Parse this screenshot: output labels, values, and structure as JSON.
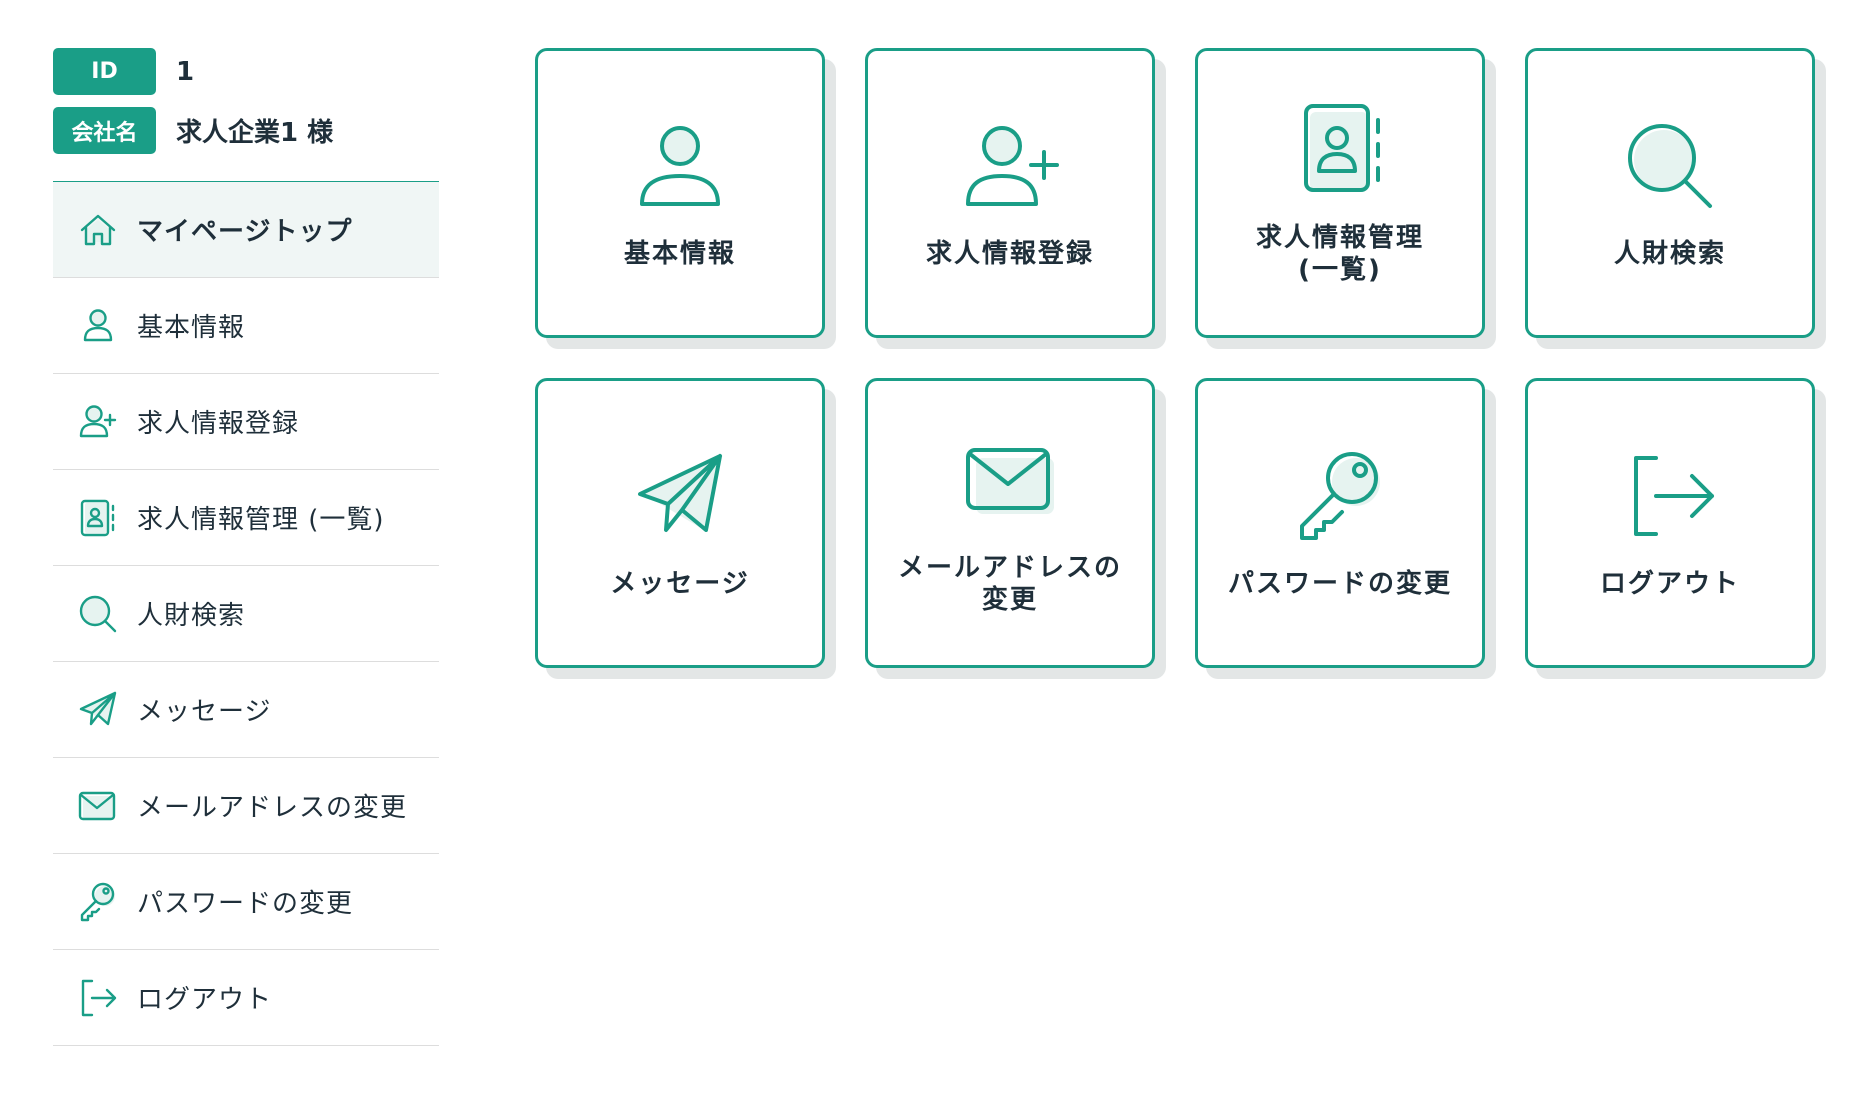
{
  "profile": {
    "id_label": "ID",
    "id_value": "1",
    "company_label": "会社名",
    "company_value": "求人企業1 様"
  },
  "sidebar": {
    "items": [
      {
        "label": "マイページトップ",
        "icon": "home-icon",
        "active": true
      },
      {
        "label": "基本情報",
        "icon": "user-icon"
      },
      {
        "label": "求人情報登録",
        "icon": "user-plus-icon"
      },
      {
        "label": "求人情報管理 (一覧)",
        "icon": "contact-book-icon"
      },
      {
        "label": "人財検索",
        "icon": "search-icon"
      },
      {
        "label": "メッセージ",
        "icon": "paper-plane-icon"
      },
      {
        "label": "メールアドレスの変更",
        "icon": "envelope-icon"
      },
      {
        "label": "パスワードの変更",
        "icon": "key-icon"
      },
      {
        "label": "ログアウト",
        "icon": "logout-icon"
      }
    ]
  },
  "tiles": [
    {
      "label": "基本情報",
      "icon": "user-icon"
    },
    {
      "label": "求人情報登録",
      "icon": "user-plus-icon"
    },
    {
      "label": "求人情報管理\n(一覧)",
      "icon": "contact-book-icon"
    },
    {
      "label": "人財検索",
      "icon": "search-icon"
    },
    {
      "label": "メッセージ",
      "icon": "paper-plane-icon"
    },
    {
      "label": "メールアドレスの\n変更",
      "icon": "envelope-icon"
    },
    {
      "label": "パスワードの変更",
      "icon": "key-icon"
    },
    {
      "label": "ログアウト",
      "icon": "logout-icon"
    }
  ],
  "colors": {
    "accent": "#1a9e87",
    "active_bg": "#f0f6f5",
    "text": "#1f2f3a",
    "shadow": "#e3e6e6"
  }
}
